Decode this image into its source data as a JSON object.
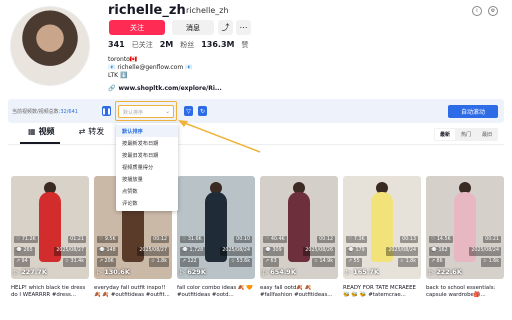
{
  "profile": {
    "username": "richelle_zh",
    "handle": "richelle_zh",
    "follow_label": "关注",
    "message_label": "消息",
    "share_icon": "share-icon",
    "more_icon": "more-icon",
    "stats": [
      {
        "value": "341",
        "label": "已关注"
      },
      {
        "value": "2M",
        "label": "粉丝"
      },
      {
        "value": "136.3M",
        "label": "赞"
      }
    ],
    "bio_lines": [
      "toronto🇨🇦",
      "📧 richelle@genflow.com 📧",
      "LTK ⬇️"
    ],
    "link": "www.shopltk.com/explore/Ri..."
  },
  "toolbar": {
    "count_label": "当前视频数/视频总数:",
    "count_value": "32/641",
    "select_placeholder": "默认排序",
    "auto_scroll_label": "自动滚动"
  },
  "dropdown": {
    "options": [
      "默认排序",
      "按最新发布日期",
      "按最旧发布日期",
      "视频质量得分",
      "按播放量",
      "点赞数",
      "评论数"
    ],
    "selected_index": 0
  },
  "tabs": [
    {
      "label": "视频",
      "icon": "grid-icon",
      "active": true
    },
    {
      "label": "转发",
      "icon": "repost-icon",
      "active": false
    }
  ],
  "sort_tabs": [
    {
      "label": "最新",
      "on": true
    },
    {
      "label": "热门",
      "on": false
    },
    {
      "label": "最旧",
      "on": false
    }
  ],
  "cards": [
    {
      "likes": "71.2K",
      "duration": "01:21",
      "comments": "265",
      "date": "2025/08/27",
      "shares": "94",
      "score": "31.4k",
      "plays": "227.7K",
      "caption": "HELP! which black tie dress do I WEARRRR #dress...",
      "bg": "#d9d2c9",
      "fig": "#d32c2c"
    },
    {
      "likes": "9.5K",
      "duration": "00:12",
      "comments": "148",
      "date": "2025/08/27",
      "shares": "206",
      "score": "1.8k",
      "plays": "130.6K",
      "caption": "everyday fall outfit inspo!!🍂 🍂 #outfitideas #outfit...",
      "bg": "#cbb9a8",
      "fig": "#5a3b2a"
    },
    {
      "likes": "31.6K",
      "duration": "00:10",
      "comments": "1,728",
      "date": "2025/08/24",
      "shares": "122",
      "score": "53.6k",
      "plays": "629K",
      "caption": "fall color combo ideas 🍂 🧡 #outfitideas #ootd...",
      "bg": "#b9c2c6",
      "fig": "#1f2b36"
    },
    {
      "likes": "40.4K",
      "duration": "00:12",
      "comments": "309",
      "date": "2025/08/26",
      "shares": "63",
      "score": "14.9k",
      "plays": "654.9K",
      "caption": "easy fall ootd🍂 🍂 #fallfashion #outfitideas...",
      "bg": "#d4cfc8",
      "fig": "#6d2f3b"
    },
    {
      "likes": "7.3K",
      "duration": "00:13",
      "comments": "179",
      "date": "2025/08/24",
      "shares": "55",
      "score": "1.8k",
      "plays": "165.7K",
      "caption": "READY FOR TATE MCRAEEE 🐝 🐝 🐝 #tatemcrae...",
      "bg": "#e6e1d9",
      "fig": "#f1e27a"
    },
    {
      "likes": "14.5K",
      "duration": "00:21",
      "comments": "162",
      "date": "2025/08/24",
      "shares": "86",
      "score": "1.6k",
      "plays": "222.6K",
      "caption": "back to school essentials: capsule wardrobe🎒...",
      "bg": "#d6d0cb",
      "fig": "#e7b7c2"
    }
  ]
}
